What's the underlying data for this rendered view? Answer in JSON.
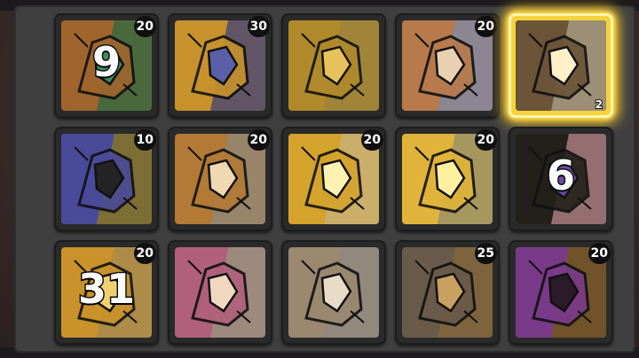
{
  "inventory": {
    "slots": [
      {
        "icon": "chest-icon",
        "count": "20",
        "level": "9",
        "selected": false,
        "colors": [
          "#a0652d",
          "#5b3a1c",
          "#3b8f5a"
        ]
      },
      {
        "icon": "wing-icon",
        "count": "30",
        "level": "",
        "selected": false,
        "colors": [
          "#c7922b",
          "#6b4a18",
          "#5a5fa8"
        ]
      },
      {
        "icon": "claw-icon",
        "count": "",
        "level": "",
        "selected": false,
        "colors": [
          "#b08a2a",
          "#4d3a12",
          "#e6c25a"
        ]
      },
      {
        "icon": "hammer-icon",
        "count": "20",
        "level": "",
        "selected": false,
        "colors": [
          "#b87a4a",
          "#1d2e6e",
          "#e8d0b0"
        ]
      },
      {
        "icon": "shatter-fist-icon",
        "count": "2",
        "level": "",
        "selected": true,
        "colors": [
          "#6b5438",
          "#241a10",
          "#fff0c8"
        ]
      },
      {
        "icon": "knight-helmet-icon",
        "count": "10",
        "level": "",
        "selected": false,
        "colors": [
          "#4a4a9a",
          "#e8c84a",
          "#242424"
        ]
      },
      {
        "icon": "horse-head-icon",
        "count": "20",
        "level": "",
        "selected": false,
        "colors": [
          "#b27a35",
          "#2b1e12",
          "#f0d8b0"
        ]
      },
      {
        "icon": "crest-shield-icon",
        "count": "20",
        "level": "",
        "selected": false,
        "colors": [
          "#d4a32b",
          "#8a5c12",
          "#fff2b0"
        ]
      },
      {
        "icon": "crown-icon",
        "count": "20",
        "level": "",
        "selected": false,
        "colors": [
          "#e0b43a",
          "#3a2a10",
          "#fff0a0"
        ]
      },
      {
        "icon": "tower-shield-icon",
        "count": "",
        "level": "6",
        "selected": false,
        "colors": [
          "#23201a",
          "#c89a30",
          "#6a4aa8"
        ]
      },
      {
        "icon": "gold-helmet-icon",
        "count": "20",
        "level": "31",
        "selected": false,
        "colors": [
          "#c9922b",
          "#5a3a14",
          "#f0d070"
        ]
      },
      {
        "icon": "banner-icon",
        "count": "",
        "level": "",
        "selected": false,
        "colors": [
          "#b0607a",
          "#3a2a2a",
          "#f0d8c0"
        ]
      },
      {
        "icon": "gauntlet-icon",
        "count": "",
        "level": "",
        "selected": false,
        "colors": [
          "#9a8870",
          "#2a2420",
          "#e8dcc8"
        ]
      },
      {
        "icon": "mace-icon",
        "count": "25",
        "level": "",
        "selected": false,
        "colors": [
          "#6a5a4a",
          "#241c14",
          "#c8a060"
        ]
      },
      {
        "icon": "ornate-helmet-icon",
        "count": "20",
        "level": "",
        "selected": false,
        "colors": [
          "#7a3a8a",
          "#c89a2a",
          "#2a1a2a"
        ]
      }
    ]
  }
}
